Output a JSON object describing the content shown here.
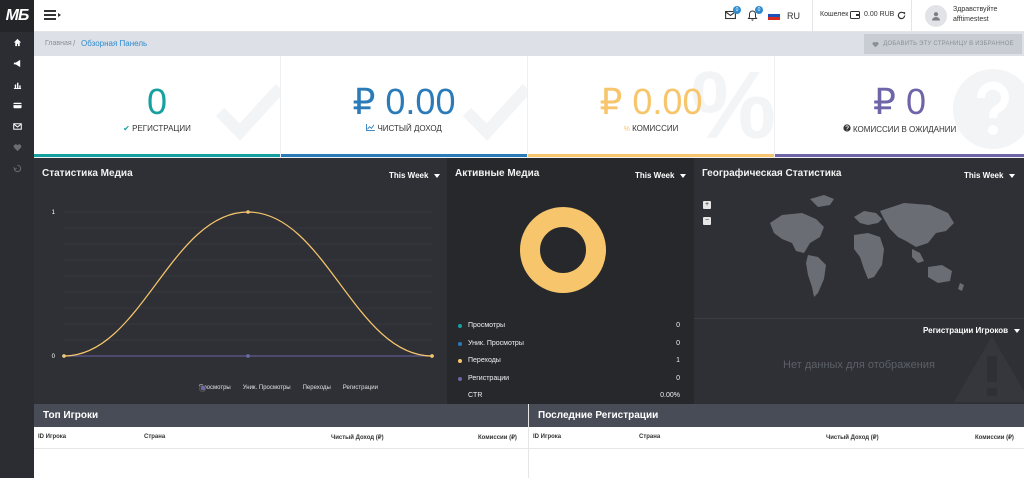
{
  "logo": "МБ",
  "topbar": {
    "mail_count": "0",
    "notif_count": "0",
    "language": "RU",
    "wallet_label": "Кошелек",
    "wallet_amount": "0.00 RUB",
    "greeting": "Здравствуйте",
    "username": "afftimestest"
  },
  "breadcrumb": {
    "home": "Главная",
    "separator": "/",
    "current": "Обзорная Панель"
  },
  "favorite_button": "ДОБАВИТЬ ЭТУ СТРАНИЦУ В ИЗБРАННОЕ",
  "stats": [
    {
      "value": "0",
      "label": "РЕГИСТРАЦИИ",
      "color": "#17a0a0"
    },
    {
      "value": "₽ 0.00",
      "label": "ЧИСТЫЙ ДОХОД",
      "color": "#2b7bb9"
    },
    {
      "value": "₽ 0.00",
      "label": "КОМИССИИ",
      "color": "#f7c56b"
    },
    {
      "value": "₽ 0",
      "label": "КОМИССИИ В ОЖИДАНИИ",
      "color": "#6e65a8"
    }
  ],
  "media_stats": {
    "title": "Статистика Медиа",
    "period": "This Week",
    "legend": [
      "Просмотры",
      "Уник. Просмотры",
      "Переходы",
      "Регистрации"
    ]
  },
  "chart_data": {
    "type": "line",
    "x": [
      0,
      1,
      2
    ],
    "series": [
      {
        "name": "Просмотры",
        "values": [
          0,
          0,
          0
        ],
        "color": "#17a0a0"
      },
      {
        "name": "Уник. Просмотры",
        "values": [
          0,
          0,
          0
        ],
        "color": "#2b7bb9"
      },
      {
        "name": "Переходы",
        "values": [
          0,
          1,
          0
        ],
        "color": "#f7c56b"
      },
      {
        "name": "Регистрации",
        "values": [
          0,
          0,
          0
        ],
        "color": "#6e65a8"
      }
    ],
    "ylim": [
      0,
      1
    ],
    "yticks": [
      "0",
      "1"
    ],
    "grid": true,
    "legend_position": "bottom-right"
  },
  "active_media": {
    "title": "Активные Медиа",
    "period": "This Week",
    "rows": [
      {
        "label": "Просмотры",
        "value": "0",
        "color": "#17a0a0"
      },
      {
        "label": "Уник. Просмотры",
        "value": "0",
        "color": "#2b7bb9"
      },
      {
        "label": "Переходы",
        "value": "1",
        "color": "#f7c56b"
      },
      {
        "label": "Регистрации",
        "value": "0",
        "color": "#6e65a8"
      },
      {
        "label": "CTR",
        "value": "0.00%",
        "color": ""
      }
    ]
  },
  "geo": {
    "title": "Географическая Статистика",
    "period": "This Week",
    "zoom_in": "+",
    "zoom_out": "−",
    "players_selector": "Регистрации Игроков",
    "no_data": "Нет данных для отображения"
  },
  "top_players": {
    "title": "Топ Игроки",
    "columns": [
      "ID Игрока",
      "Страна",
      "Чистый Доход (₽)",
      "Комиссии (₽)"
    ]
  },
  "recent_regs": {
    "title": "Последние Регистрации",
    "columns": [
      "ID Игрока",
      "Страна",
      "Чистый Доход (₽)",
      "Комиссии (₽)"
    ]
  }
}
